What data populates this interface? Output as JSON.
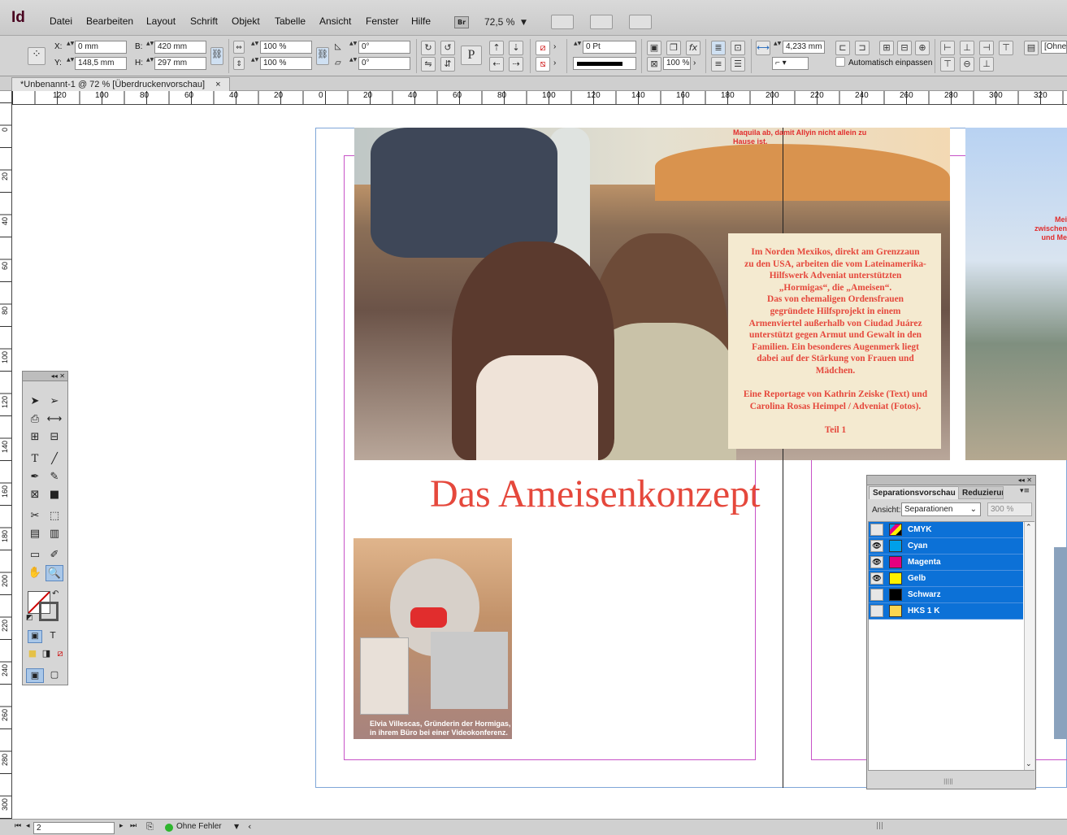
{
  "app": {
    "logo": "Id"
  },
  "menu": [
    "Datei",
    "Bearbeiten",
    "Layout",
    "Schrift",
    "Objekt",
    "Tabelle",
    "Ansicht",
    "Fenster",
    "Hilfe"
  ],
  "appbar": {
    "bridge_label": "Br",
    "zoom": "72,5 %"
  },
  "control": {
    "x_label": "X:",
    "x_value": "0 mm",
    "y_label": "Y:",
    "y_value": "148,5 mm",
    "w_label": "B:",
    "w_value": "420 mm",
    "h_label": "H:",
    "h_value": "297 mm",
    "scale_x": "100 %",
    "scale_y": "100 %",
    "rotate": "0°",
    "shear": "0°",
    "stroke_weight": "0 Pt",
    "opacity": "100 %",
    "gap": "4,233 mm",
    "autofit": "Automatisch einpassen",
    "style": "[Ohne]"
  },
  "doc_tab": {
    "title": "*Unbenannt-1 @ 72 % [Überdruckenvorschau]",
    "close": "×"
  },
  "ruler_h": [
    "120",
    "100",
    "80",
    "60",
    "40",
    "20",
    "0",
    "20",
    "40",
    "60",
    "80",
    "100",
    "120",
    "140",
    "160",
    "180",
    "200",
    "220",
    "240",
    "260",
    "280",
    "300",
    "320"
  ],
  "ruler_v": [
    "0",
    "20",
    "40",
    "60",
    "80",
    "100",
    "120",
    "140",
    "160",
    "180",
    "200",
    "220",
    "240",
    "260",
    "280",
    "300"
  ],
  "layout": {
    "caption_top": "Maquila ab, damit Allyin nicht allein zu Hause ist.",
    "body": "Im Norden Mexikos, direkt am Grenzzaun\nzu den USA, arbeiten die vom Lateinamerika-\nHilfswerk Adveniat unterstützten\n„Hormigas“, die „Ameisen“.\nDas von ehemaligen Ordensfrauen\ngegründete Hilfsprojekt in einem\nArmenviertel außerhalb von Ciudad Juárez\nunterstützt gegen Armut und Gewalt in den\nFamilien.  Ein besonderes Augenmerk liegt\ndabei auf der Stärkung von Frauen und\nMädchen.\n\nEine Reportage von Kathrin Zeiske (Text) und\nCarolina Rosas Heimpel / Adveniat (Fotos).\n\nTeil 1",
    "headline": "Das Ameisenkonzept",
    "photo_caption": "Elvia Villescas, Gründerin der Hormigas, in ihrem Büro bei einer Videokonferenz.",
    "right_text": "Mei\nzwischen\nund Me"
  },
  "sep_panel": {
    "tab1": "Separationsvorschau",
    "tab2": "Reduzierungsvorschau",
    "ansicht_label": "Ansicht:",
    "ansicht_value": "Separationen",
    "zoom": "300 %",
    "rows": [
      {
        "name": "CMYK",
        "visible": false,
        "color": "#000000"
      },
      {
        "name": "Cyan",
        "visible": true,
        "color": "#00a0e9"
      },
      {
        "name": "Magenta",
        "visible": true,
        "color": "#e4007f"
      },
      {
        "name": "Gelb",
        "visible": true,
        "color": "#fff100"
      },
      {
        "name": "Schwarz",
        "visible": false,
        "color": "#000000"
      },
      {
        "name": "HKS 1 K",
        "visible": false,
        "color": "#fcd54f"
      }
    ]
  },
  "status": {
    "page": "2",
    "errors": "Ohne Fehler"
  }
}
